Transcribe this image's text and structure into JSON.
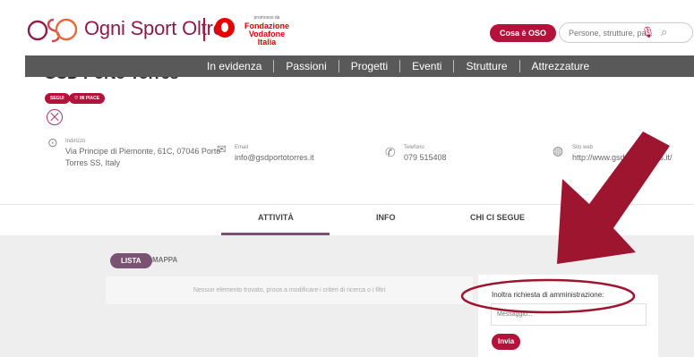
{
  "header": {
    "logo_text": "Ogni Sport Oltre",
    "sponsor_small": "promosso da",
    "sponsor_line1": "Fondazione",
    "sponsor_line2": "Vodafone",
    "sponsor_line3": "Italia",
    "cosa_button": "Cosa è OSO",
    "search_placeholder": "Persone, strutture, pa..."
  },
  "nav": {
    "items": [
      {
        "label": "In evidenza"
      },
      {
        "label": "Passioni"
      },
      {
        "label": "Progetti"
      },
      {
        "label": "Eventi"
      },
      {
        "label": "Strutture"
      },
      {
        "label": "Attrezzature"
      }
    ]
  },
  "club": {
    "name": "GSD Porto Torres",
    "segui": "SEGUI",
    "mi_piace": "MI PIACE",
    "address_label": "Indirizzo",
    "address_line1": "Via Principe di Piemonte, 61C, 07046 Porto",
    "address_line2": "Torres SS, Italy",
    "email_label": "Email",
    "email_value": "info@gsdportotorres.it",
    "phone_label": "Telefono",
    "phone_value": "079 515408",
    "web_label": "Sito web",
    "web_value": "http://www.gsdportotorres.it/"
  },
  "tabs": [
    {
      "label": "ATTIVITÀ"
    },
    {
      "label": "INFO"
    },
    {
      "label": "CHI CI SEGUE"
    }
  ],
  "content": {
    "lista": "LISTA",
    "mappa": "MAPPA",
    "empty_message": "Nessun elemento trovato, prova a modificare i criteri di ricerca o i filtri"
  },
  "admin_panel": {
    "label": "Inoltra richiesta di amministrazione:",
    "message_placeholder": "Messaggio...",
    "send_button": "Invia"
  },
  "colors": {
    "brand": "#b3123a",
    "nav_bg": "#595959",
    "accent_purple": "#7a5272",
    "annotation": "#9e1530"
  }
}
